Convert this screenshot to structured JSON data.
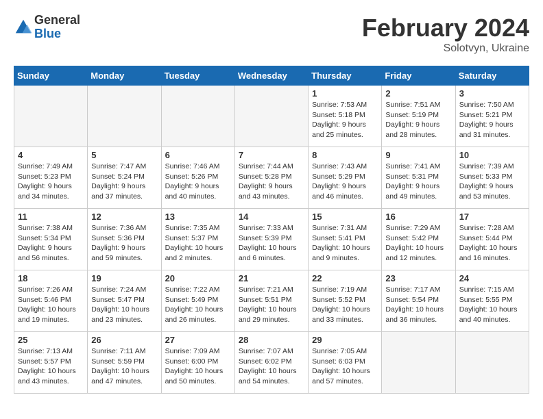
{
  "logo": {
    "general": "General",
    "blue": "Blue"
  },
  "title": "February 2024",
  "location": "Solotvyn, Ukraine",
  "days_of_week": [
    "Sunday",
    "Monday",
    "Tuesday",
    "Wednesday",
    "Thursday",
    "Friday",
    "Saturday"
  ],
  "weeks": [
    [
      {
        "day": "",
        "info": ""
      },
      {
        "day": "",
        "info": ""
      },
      {
        "day": "",
        "info": ""
      },
      {
        "day": "",
        "info": ""
      },
      {
        "day": "1",
        "info": "Sunrise: 7:53 AM\nSunset: 5:18 PM\nDaylight: 9 hours\nand 25 minutes."
      },
      {
        "day": "2",
        "info": "Sunrise: 7:51 AM\nSunset: 5:19 PM\nDaylight: 9 hours\nand 28 minutes."
      },
      {
        "day": "3",
        "info": "Sunrise: 7:50 AM\nSunset: 5:21 PM\nDaylight: 9 hours\nand 31 minutes."
      }
    ],
    [
      {
        "day": "4",
        "info": "Sunrise: 7:49 AM\nSunset: 5:23 PM\nDaylight: 9 hours\nand 34 minutes."
      },
      {
        "day": "5",
        "info": "Sunrise: 7:47 AM\nSunset: 5:24 PM\nDaylight: 9 hours\nand 37 minutes."
      },
      {
        "day": "6",
        "info": "Sunrise: 7:46 AM\nSunset: 5:26 PM\nDaylight: 9 hours\nand 40 minutes."
      },
      {
        "day": "7",
        "info": "Sunrise: 7:44 AM\nSunset: 5:28 PM\nDaylight: 9 hours\nand 43 minutes."
      },
      {
        "day": "8",
        "info": "Sunrise: 7:43 AM\nSunset: 5:29 PM\nDaylight: 9 hours\nand 46 minutes."
      },
      {
        "day": "9",
        "info": "Sunrise: 7:41 AM\nSunset: 5:31 PM\nDaylight: 9 hours\nand 49 minutes."
      },
      {
        "day": "10",
        "info": "Sunrise: 7:39 AM\nSunset: 5:33 PM\nDaylight: 9 hours\nand 53 minutes."
      }
    ],
    [
      {
        "day": "11",
        "info": "Sunrise: 7:38 AM\nSunset: 5:34 PM\nDaylight: 9 hours\nand 56 minutes."
      },
      {
        "day": "12",
        "info": "Sunrise: 7:36 AM\nSunset: 5:36 PM\nDaylight: 9 hours\nand 59 minutes."
      },
      {
        "day": "13",
        "info": "Sunrise: 7:35 AM\nSunset: 5:37 PM\nDaylight: 10 hours\nand 2 minutes."
      },
      {
        "day": "14",
        "info": "Sunrise: 7:33 AM\nSunset: 5:39 PM\nDaylight: 10 hours\nand 6 minutes."
      },
      {
        "day": "15",
        "info": "Sunrise: 7:31 AM\nSunset: 5:41 PM\nDaylight: 10 hours\nand 9 minutes."
      },
      {
        "day": "16",
        "info": "Sunrise: 7:29 AM\nSunset: 5:42 PM\nDaylight: 10 hours\nand 12 minutes."
      },
      {
        "day": "17",
        "info": "Sunrise: 7:28 AM\nSunset: 5:44 PM\nDaylight: 10 hours\nand 16 minutes."
      }
    ],
    [
      {
        "day": "18",
        "info": "Sunrise: 7:26 AM\nSunset: 5:46 PM\nDaylight: 10 hours\nand 19 minutes."
      },
      {
        "day": "19",
        "info": "Sunrise: 7:24 AM\nSunset: 5:47 PM\nDaylight: 10 hours\nand 23 minutes."
      },
      {
        "day": "20",
        "info": "Sunrise: 7:22 AM\nSunset: 5:49 PM\nDaylight: 10 hours\nand 26 minutes."
      },
      {
        "day": "21",
        "info": "Sunrise: 7:21 AM\nSunset: 5:51 PM\nDaylight: 10 hours\nand 29 minutes."
      },
      {
        "day": "22",
        "info": "Sunrise: 7:19 AM\nSunset: 5:52 PM\nDaylight: 10 hours\nand 33 minutes."
      },
      {
        "day": "23",
        "info": "Sunrise: 7:17 AM\nSunset: 5:54 PM\nDaylight: 10 hours\nand 36 minutes."
      },
      {
        "day": "24",
        "info": "Sunrise: 7:15 AM\nSunset: 5:55 PM\nDaylight: 10 hours\nand 40 minutes."
      }
    ],
    [
      {
        "day": "25",
        "info": "Sunrise: 7:13 AM\nSunset: 5:57 PM\nDaylight: 10 hours\nand 43 minutes."
      },
      {
        "day": "26",
        "info": "Sunrise: 7:11 AM\nSunset: 5:59 PM\nDaylight: 10 hours\nand 47 minutes."
      },
      {
        "day": "27",
        "info": "Sunrise: 7:09 AM\nSunset: 6:00 PM\nDaylight: 10 hours\nand 50 minutes."
      },
      {
        "day": "28",
        "info": "Sunrise: 7:07 AM\nSunset: 6:02 PM\nDaylight: 10 hours\nand 54 minutes."
      },
      {
        "day": "29",
        "info": "Sunrise: 7:05 AM\nSunset: 6:03 PM\nDaylight: 10 hours\nand 57 minutes."
      },
      {
        "day": "",
        "info": ""
      },
      {
        "day": "",
        "info": ""
      }
    ]
  ]
}
